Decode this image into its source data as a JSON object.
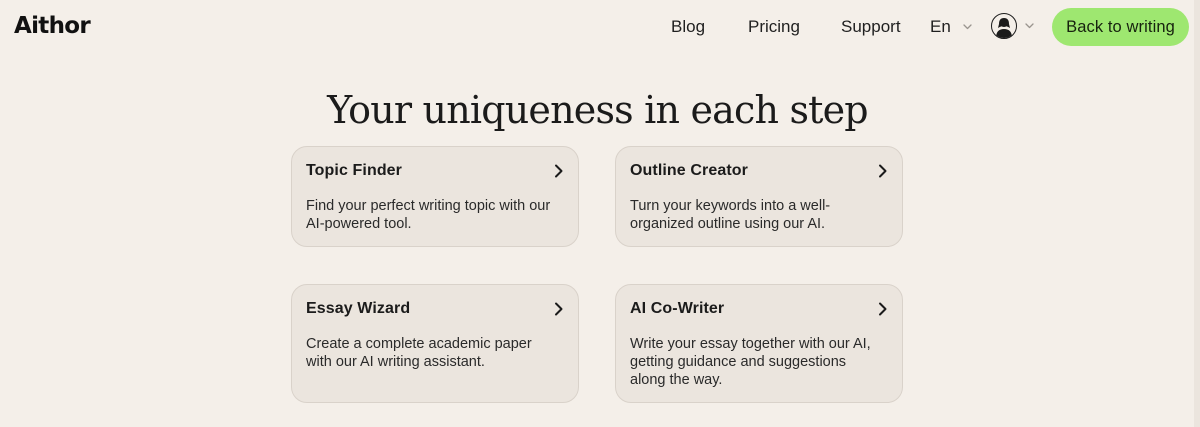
{
  "header": {
    "logo": "Aithor",
    "nav": {
      "blog": "Blog",
      "pricing": "Pricing",
      "support": "Support"
    },
    "language": "En",
    "cta": "Back to writing",
    "accent_color": "#9ee770"
  },
  "main": {
    "heading": "Your uniqueness in each step",
    "cards": [
      {
        "title": "Topic Finder",
        "description": "Find your perfect writing topic with our AI-powered tool."
      },
      {
        "title": "Outline Creator",
        "description": "Turn your keywords into a well-organized outline using our AI."
      },
      {
        "title": "Essay Wizard",
        "description": "Create a complete academic paper with our AI writing assistant."
      },
      {
        "title": "AI Co-Writer",
        "description": "Write your essay together with our AI, getting guidance and suggestions along the way."
      }
    ],
    "card_arrow_icon": "chevron-right-icon"
  },
  "background_color": "#f4efe9"
}
